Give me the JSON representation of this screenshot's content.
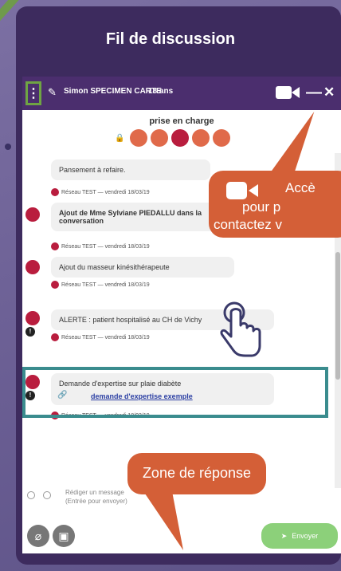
{
  "panel": {
    "title": "Fil de discussion"
  },
  "header": {
    "menu_glyph": "⋮",
    "patient": "Simon SPECIMEN CARTE",
    "age": "18 ans",
    "minimize": "—",
    "close": "✕"
  },
  "status": {
    "label": "prise en charge",
    "steps": [
      "",
      "",
      "",
      "",
      ""
    ]
  },
  "messages": [
    {
      "text": "Pansement à refaire.",
      "meta": "Réseau TEST  —  vendredi 18/03/19"
    },
    {
      "text": "Ajout de Mme Sylviane PIEDALLU dans la conversation",
      "meta": "Réseau TEST  —  vendredi 18/03/19"
    },
    {
      "text": "Ajout du masseur kinésithérapeute",
      "meta": "Réseau TEST  —  vendredi 18/03/19"
    },
    {
      "text": "ALERTE : patient hospitalisé au CH de Vichy",
      "meta": "Réseau TEST  —  vendredi 18/03/19"
    },
    {
      "text": "Demande d'expertise sur plaie diabète",
      "attachment": "demande d'expertise exemple",
      "meta": "Réseau TEST  —  vendredi 18/03/19"
    }
  ],
  "callouts": {
    "video": [
      "Accè",
      "pour p",
      "contactez v"
    ],
    "reply": "Zone de réponse"
  },
  "composer": {
    "placeholder": "Rédiger un message (Entrée pour envoyer)",
    "send_label": "Envoyer"
  },
  "colors": {
    "accent": "#d45f37",
    "header": "#4b2e6e",
    "highlight": "#3a8c8e",
    "frame": "#3d2b5e"
  }
}
